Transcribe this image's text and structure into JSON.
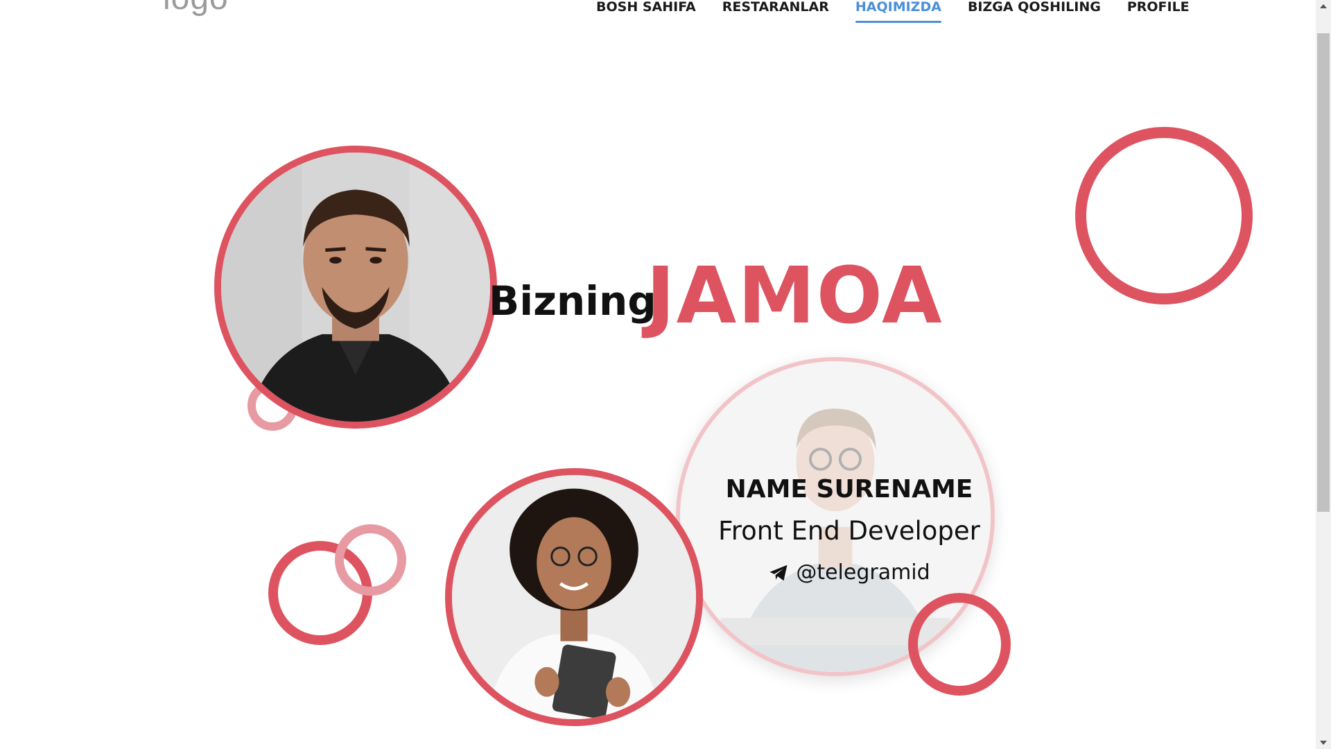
{
  "header": {
    "logo": "logo",
    "nav": [
      {
        "label": "BOSH SAHIFA"
      },
      {
        "label": "RESTARANLAR"
      },
      {
        "label": "HAQIMIZDA"
      },
      {
        "label": "BIZGA QOSHILING"
      },
      {
        "label": "PROFILE"
      }
    ],
    "active_nav": "HAQIMIZDA"
  },
  "hero": {
    "title_small": "Bizning",
    "title_big": "JAMOA"
  },
  "member": {
    "name": "NAME SURENAME",
    "role": "Front End Developer",
    "telegram": "@telegramid",
    "telegram_icon": "telegram-plane-icon"
  },
  "colors": {
    "accent": "#dd5360",
    "accent_light": "#e89aa2",
    "nav_active": "#4a8fd8",
    "text": "#111111"
  }
}
